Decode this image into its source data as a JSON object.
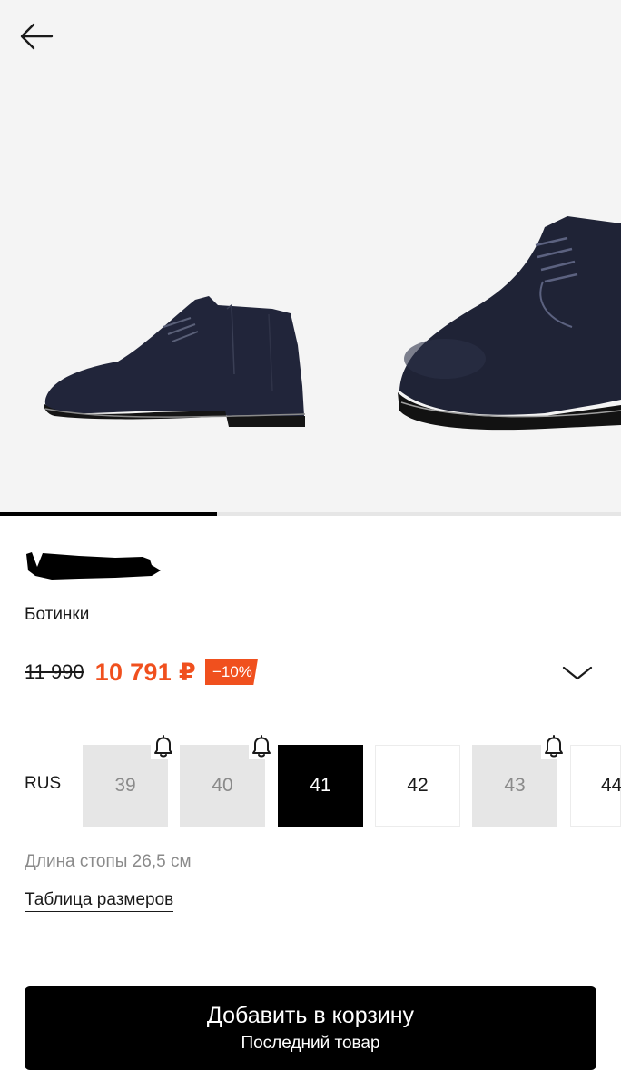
{
  "gallery": {
    "image_count_progress": 0.35
  },
  "product": {
    "category": "Ботинки",
    "old_price": "11 990",
    "new_price": "10 791 ₽",
    "discount": "−10%"
  },
  "sizes": {
    "system": "RUS",
    "items": [
      {
        "label": "39",
        "state": "unavailable",
        "notify": true
      },
      {
        "label": "40",
        "state": "unavailable",
        "notify": true
      },
      {
        "label": "41",
        "state": "selected",
        "notify": false
      },
      {
        "label": "42",
        "state": "available",
        "notify": false
      },
      {
        "label": "43",
        "state": "unavailable",
        "notify": true
      },
      {
        "label": "44",
        "state": "available",
        "notify": false
      }
    ],
    "foot_length": "Длина стопы 26,5 см",
    "size_chart_link": "Таблица размеров"
  },
  "cart": {
    "label": "Добавить в корзину",
    "sub_label": "Последний товар"
  },
  "colors": {
    "accent": "#f0501e",
    "unavailable_bg": "#e6e6e6"
  }
}
